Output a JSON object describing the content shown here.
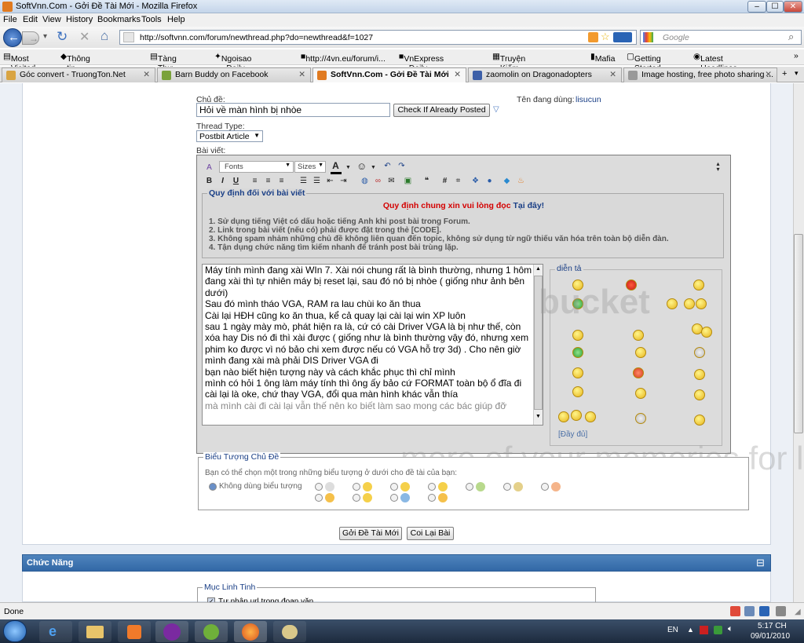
{
  "window": {
    "title": "SoftVnn.Com - Gởi Đề Tài Mới - Mozilla Firefox",
    "controls": [
      "–",
      "☐",
      "✕"
    ]
  },
  "menu": [
    "File",
    "Edit",
    "View",
    "History",
    "Bookmarks",
    "Tools",
    "Help"
  ],
  "nav": {
    "url": "http://softvnn.com/forum/newthread.php?do=newthread&f=1027",
    "search_placeholder": "Google"
  },
  "bookmarks": [
    "Most Visited",
    "Thông tin công nghệ",
    "Tàng Thư Viện",
    "Ngoisao - Daily News",
    "http://4vn.eu/forum/i...",
    "VnExpress - Daily News",
    "Truyện Kiếm Hiệp - Tr...",
    "Mafia",
    "Getting Started",
    "Latest Headlines"
  ],
  "tabs": [
    {
      "label": "Góc convert - TruongTon.Net",
      "color": "#d9a441"
    },
    {
      "label": "Barn Buddy on Facebook",
      "color": "#7aa23b"
    },
    {
      "label": "SoftVnn.Com - Gởi Đề Tài Mới",
      "color": "#e07a20"
    },
    {
      "label": "zaomolin on Dragonadopters",
      "color": "#3c5fa8"
    },
    {
      "label": "Image hosting, free photo sharing ...",
      "color": "#999999"
    }
  ],
  "form": {
    "title_label": "Chủ đề:",
    "title_value": "Hỏi về màn hình bị nhòe",
    "check_button": "Check If Already Posted",
    "user_label": "Tên đang dùng:",
    "user_name": "lisucun",
    "thread_type_label": "Thread Type:",
    "thread_type_value": "Postbit Article",
    "post_label": "Bài viết:"
  },
  "toolbar": {
    "font": "Fonts",
    "size": "Sizes"
  },
  "rules": {
    "legend": "Quy định đối với bài viết",
    "headline": "Quy định chung xin vui lòng đọc",
    "headline_link": "Tại đây!",
    "items": [
      "1. Sử dụng tiếng Việt có dấu hoặc tiếng Anh khi post bài trong Forum.",
      "2. Link trong bài viết (nếu có) phải được đặt trong thẻ [CODE].",
      "3. Không spam nhảm những chủ đề không liên quan đến topic, không sử dụng từ ngữ thiếu văn hóa trên toàn bộ diễn đàn.",
      "4. Tận dụng chức năng tìm kiếm nhanh để tránh post bài trùng lặp."
    ]
  },
  "message_lines": [
    "Máy tính mình đang xài WIn 7. Xài nói chung rất là bình thường, nhưng 1 hôm",
    "đang xài thì tự nhiên máy bị reset lại, sau đó nó bị nhòe ( giống như ảnh bên",
    "dưới)",
    "Sau đó mình tháo VGA, RAM ra lau chùi ko ăn thua",
    "Cài lại HĐH cũng ko ăn thua, kể cả quay lại cài lại win XP luôn",
    "sau 1 ngày mày mò, phát hiện ra là, cứ có cài Driver VGA là bị như thế, còn",
    "xóa hay Dis nó đi thì xài được ( giống như là bình thường vậy đó, nhưng xem",
    "phim ko được vì nó bảo chi xem được nếu có VGA hỗ trợ 3d) . Cho nên giờ",
    "mình đang xài mà phải DIS Driver VGA đi",
    "bạn nào biết hiện tượng này và cách khắc phục thì chỉ mình",
    "mình có hỏi 1 ông làm máy tính thì ông ấy bảo cứ FORMAT toàn bộ ổ đĩa đi",
    "cài lại là oke, chứ thay VGA, đổi qua màn hình khác vẫn thía",
    "mà mình cài đi cài lại vẫn thế nên ko biết làm sao mong các bác giúp đỡ"
  ],
  "smilies": {
    "legend": "diễn tả",
    "more": "[Đầy đủ]"
  },
  "post_icons": {
    "legend": "Biểu Tượng Chủ Đề",
    "hint": "Bạn có thể chọn một trong những biểu tượng ở dưới cho đề tài của bạn:",
    "none_label": "Không dùng biểu tượng"
  },
  "actions": {
    "submit": "Gởi Đề Tài Mới",
    "preview": "Coi Lại Bài"
  },
  "function_bar": {
    "title": "Chức Năng",
    "collapse": "⊟"
  },
  "misc": {
    "legend": "Mục Linh Tinh",
    "auto_url": "Tự nhận url trong đoạn văn"
  },
  "watermark": {
    "brand": "bucket",
    "tagline": "more of your memories for less"
  },
  "status": {
    "text": "Done"
  },
  "taskbar": {
    "lang": "EN",
    "time": "5:17 CH",
    "date": "09/01/2010"
  }
}
